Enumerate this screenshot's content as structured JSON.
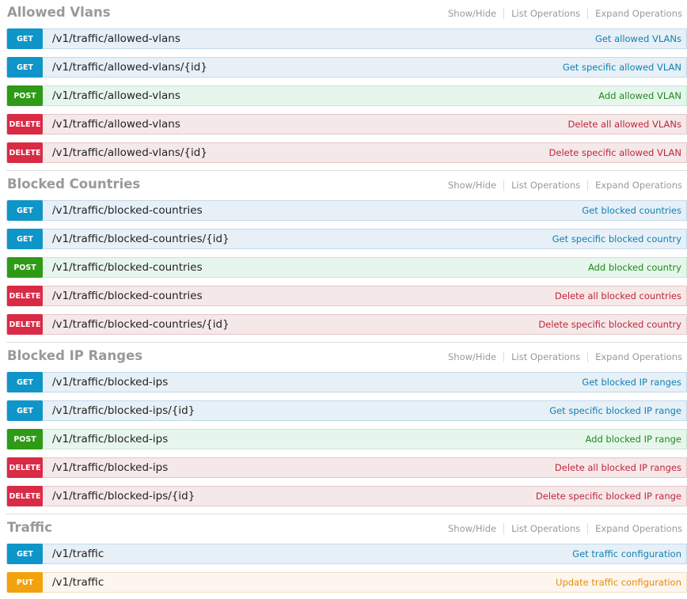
{
  "resources": [
    {
      "title": "Allowed Vlans",
      "actions": [
        "Show/Hide",
        "List Operations",
        "Expand Operations"
      ],
      "operations": [
        {
          "method": "GET",
          "path": "/v1/traffic/allowed-vlans",
          "summary": "Get allowed VLANs"
        },
        {
          "method": "GET",
          "path": "/v1/traffic/allowed-vlans/{id}",
          "summary": "Get specific allowed VLAN"
        },
        {
          "method": "POST",
          "path": "/v1/traffic/allowed-vlans",
          "summary": "Add allowed VLAN"
        },
        {
          "method": "DELETE",
          "path": "/v1/traffic/allowed-vlans",
          "summary": "Delete all allowed VLANs"
        },
        {
          "method": "DELETE",
          "path": "/v1/traffic/allowed-vlans/{id}",
          "summary": "Delete specific allowed VLAN"
        }
      ]
    },
    {
      "title": "Blocked Countries",
      "actions": [
        "Show/Hide",
        "List Operations",
        "Expand Operations"
      ],
      "operations": [
        {
          "method": "GET",
          "path": "/v1/traffic/blocked-countries",
          "summary": "Get blocked countries"
        },
        {
          "method": "GET",
          "path": "/v1/traffic/blocked-countries/{id}",
          "summary": "Get specific blocked country"
        },
        {
          "method": "POST",
          "path": "/v1/traffic/blocked-countries",
          "summary": "Add blocked country"
        },
        {
          "method": "DELETE",
          "path": "/v1/traffic/blocked-countries",
          "summary": "Delete all blocked countries"
        },
        {
          "method": "DELETE",
          "path": "/v1/traffic/blocked-countries/{id}",
          "summary": "Delete specific blocked country"
        }
      ]
    },
    {
      "title": "Blocked IP Ranges",
      "actions": [
        "Show/Hide",
        "List Operations",
        "Expand Operations"
      ],
      "operations": [
        {
          "method": "GET",
          "path": "/v1/traffic/blocked-ips",
          "summary": "Get blocked IP ranges"
        },
        {
          "method": "GET",
          "path": "/v1/traffic/blocked-ips/{id}",
          "summary": "Get specific blocked IP range"
        },
        {
          "method": "POST",
          "path": "/v1/traffic/blocked-ips",
          "summary": "Add blocked IP range"
        },
        {
          "method": "DELETE",
          "path": "/v1/traffic/blocked-ips",
          "summary": "Delete all blocked IP ranges"
        },
        {
          "method": "DELETE",
          "path": "/v1/traffic/blocked-ips/{id}",
          "summary": "Delete specific blocked IP range"
        }
      ]
    },
    {
      "title": "Traffic",
      "actions": [
        "Show/Hide",
        "List Operations",
        "Expand Operations"
      ],
      "operations": [
        {
          "method": "GET",
          "path": "/v1/traffic",
          "summary": "Get traffic configuration"
        },
        {
          "method": "PUT",
          "path": "/v1/traffic",
          "summary": "Update traffic configuration"
        }
      ]
    }
  ],
  "colors": {
    "get": "#0f95c8",
    "post": "#2e9a16",
    "delete": "#d92b45",
    "put": "#f2a20c"
  }
}
